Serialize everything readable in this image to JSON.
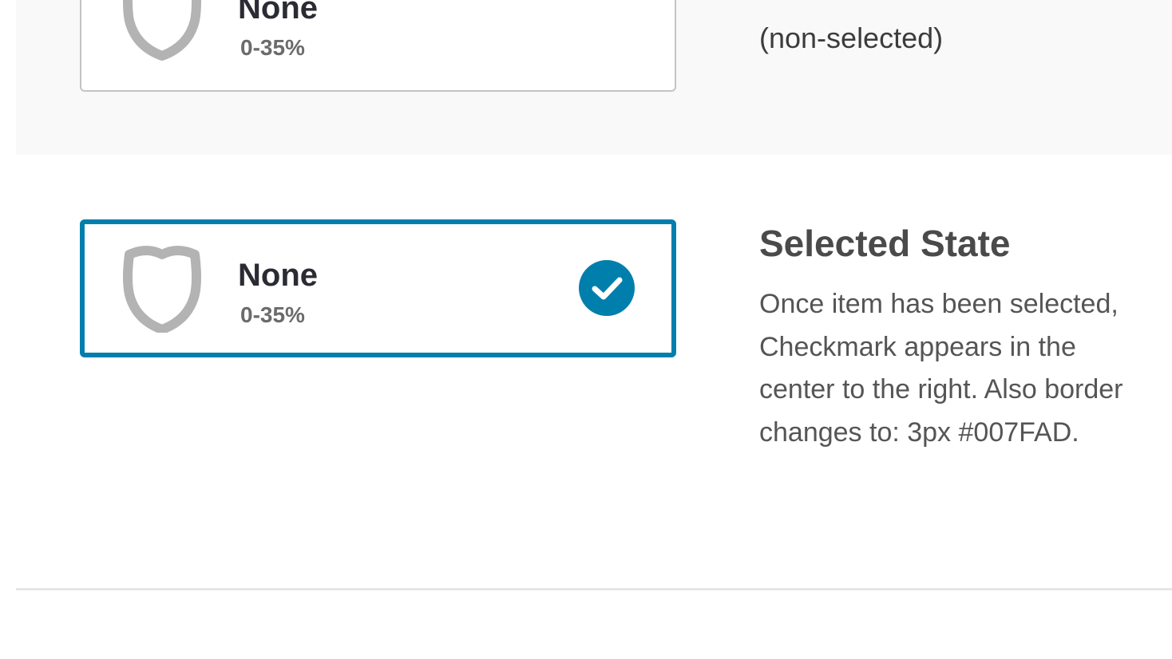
{
  "unselected_card": {
    "title": "None",
    "range": "0-35%",
    "icon": "shield-icon",
    "border_color": "#C4C4C4"
  },
  "unselected_description": "(non-selected)",
  "selected_card": {
    "title": "None",
    "range": "0-35%",
    "icon": "shield-icon",
    "check_icon": "checkmark-icon",
    "border_color": "#007FAD"
  },
  "selected_state": {
    "heading": "Selected State",
    "body": "Once item has been selected, Checkmark appears in the center to the right. Also border changes to:   3px #007FAD."
  },
  "colors": {
    "accent": "#007FAD",
    "shield": "#B3B3B3",
    "section_bg": "#F9F9F9"
  }
}
